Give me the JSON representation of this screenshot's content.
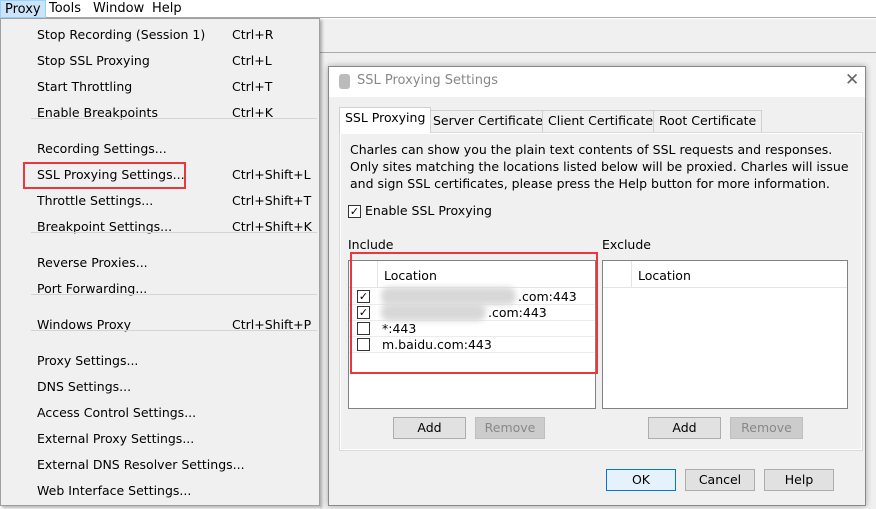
{
  "menubar": {
    "items": [
      "Proxy",
      "Tools",
      "Window",
      "Help"
    ]
  },
  "proxy_menu": {
    "items": [
      {
        "label": "Stop Recording (Session 1)",
        "shortcut": "Ctrl+R"
      },
      {
        "label": "Stop SSL Proxying",
        "shortcut": "Ctrl+L"
      },
      {
        "label": "Start Throttling",
        "shortcut": "Ctrl+T"
      },
      {
        "label": "Enable Breakpoints",
        "shortcut": "Ctrl+K"
      },
      {
        "label": "Recording Settings...",
        "shortcut": ""
      },
      {
        "label": "SSL Proxying Settings...",
        "shortcut": "Ctrl+Shift+L"
      },
      {
        "label": "Throttle Settings...",
        "shortcut": "Ctrl+Shift+T"
      },
      {
        "label": "Breakpoint Settings...",
        "shortcut": "Ctrl+Shift+K"
      },
      {
        "label": "Reverse Proxies...",
        "shortcut": ""
      },
      {
        "label": "Port Forwarding...",
        "shortcut": ""
      },
      {
        "label": "Windows Proxy",
        "shortcut": "Ctrl+Shift+P"
      },
      {
        "label": "Proxy Settings...",
        "shortcut": ""
      },
      {
        "label": "DNS Settings...",
        "shortcut": ""
      },
      {
        "label": "Access Control Settings...",
        "shortcut": ""
      },
      {
        "label": "External Proxy Settings...",
        "shortcut": ""
      },
      {
        "label": "External DNS Resolver Settings...",
        "shortcut": ""
      },
      {
        "label": "Web Interface Settings...",
        "shortcut": ""
      }
    ]
  },
  "dialog": {
    "title": "SSL Proxying Settings",
    "tabs": [
      "SSL Proxying",
      "Server Certificates",
      "Client Certificates",
      "Root Certificate"
    ],
    "description": "Charles can show you the plain text contents of SSL requests and responses. Only sites matching the locations listed below will be proxied. Charles will issue and sign SSL certificates, please press the Help button for more information.",
    "enable_label": "Enable SSL Proxying",
    "enable_checked": true,
    "include": {
      "label": "Include",
      "column": "Location",
      "rows": [
        {
          "checked": true,
          "location": ".com:443"
        },
        {
          "checked": true,
          "location": ".com:443"
        },
        {
          "checked": false,
          "location": "*:443"
        },
        {
          "checked": false,
          "location": "m.baidu.com:443"
        }
      ],
      "add": "Add",
      "remove": "Remove"
    },
    "exclude": {
      "label": "Exclude",
      "column": "Location",
      "rows": [],
      "add": "Add",
      "remove": "Remove"
    },
    "ok": "OK",
    "cancel": "Cancel",
    "help": "Help"
  },
  "colors": {
    "highlight": "#e8383d",
    "menu_active": "#cce4f7",
    "ok_border": "#0078d7"
  }
}
